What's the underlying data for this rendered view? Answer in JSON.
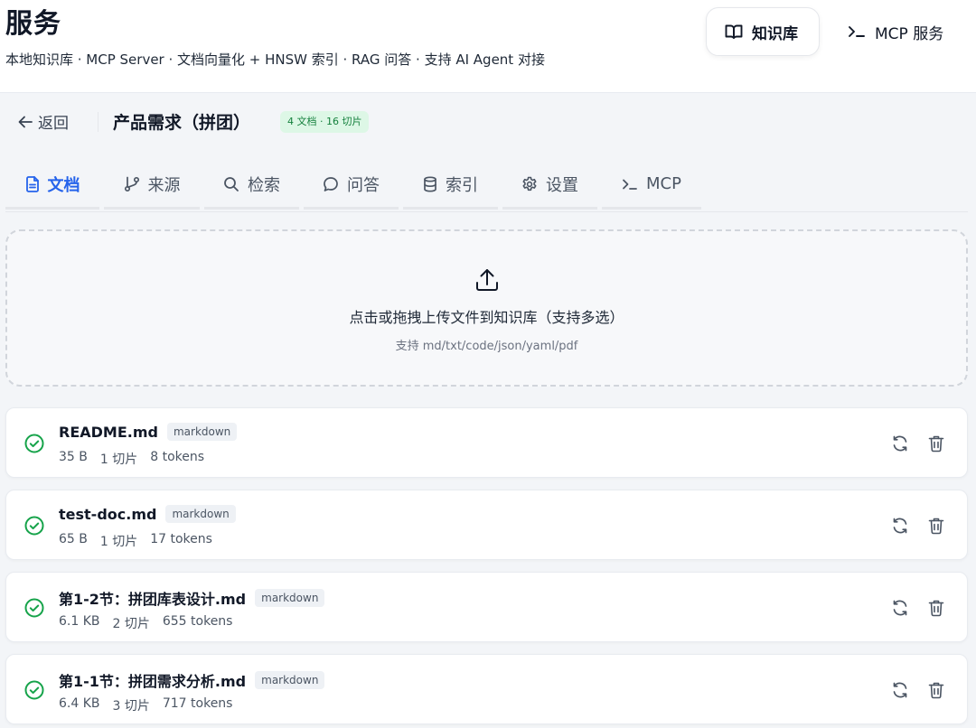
{
  "header": {
    "title": "服务",
    "subtitle": "本地知识库 · MCP Server · 文档向量化 + HNSW 索引 · RAG 问答 · 支持 AI Agent 对接",
    "nav": [
      {
        "label": "知识库",
        "icon": "book-open-icon",
        "active": true
      },
      {
        "label": "MCP 服务",
        "icon": "terminal-icon",
        "active": false
      }
    ]
  },
  "kb": {
    "back_label": "返回",
    "name": "产品需求（拼团）",
    "badge": "4 文档 · 16 切片"
  },
  "tabs": [
    {
      "label": "文档",
      "icon": "file-text-icon",
      "active": true
    },
    {
      "label": "来源",
      "icon": "git-branch-icon",
      "active": false
    },
    {
      "label": "检索",
      "icon": "search-icon",
      "active": false
    },
    {
      "label": "问答",
      "icon": "chat-bubble-icon",
      "active": false
    },
    {
      "label": "索引",
      "icon": "database-icon",
      "active": false
    },
    {
      "label": "设置",
      "icon": "gear-icon",
      "active": false
    },
    {
      "label": "MCP",
      "icon": "terminal-icon",
      "active": false
    }
  ],
  "upload": {
    "title": "点击或拖拽上传文件到知识库（支持多选）",
    "hint": "支持 md/txt/code/json/yaml/pdf",
    "icon": "upload-icon"
  },
  "documents": [
    {
      "name": "README.md",
      "type": "markdown",
      "size": "35 B",
      "chunks": "1 切片",
      "tokens": "8 tokens",
      "status": "indexed"
    },
    {
      "name": "test-doc.md",
      "type": "markdown",
      "size": "65 B",
      "chunks": "1 切片",
      "tokens": "17 tokens",
      "status": "indexed"
    },
    {
      "name": "第1-2节：拼团库表设计.md",
      "type": "markdown",
      "size": "6.1 KB",
      "chunks": "2 切片",
      "tokens": "655 tokens",
      "status": "indexed"
    },
    {
      "name": "第1-1节：拼团需求分析.md",
      "type": "markdown",
      "size": "6.4 KB",
      "chunks": "3 切片",
      "tokens": "717 tokens",
      "status": "indexed"
    }
  ],
  "colors": {
    "accent": "#2563eb",
    "success": "#16a34a",
    "badge_bg": "#ddf7e6",
    "badge_text": "#15803d"
  }
}
